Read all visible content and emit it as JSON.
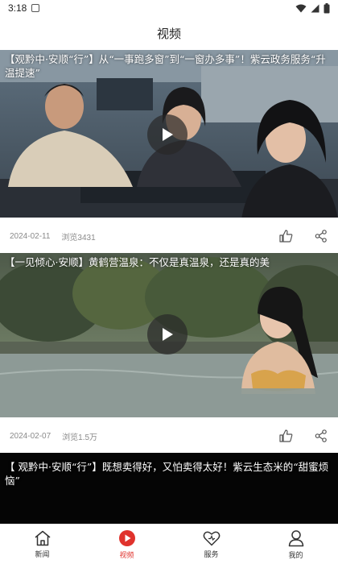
{
  "status_bar": {
    "time": "3:18"
  },
  "header": {
    "title": "视频"
  },
  "videos": [
    {
      "caption": "【观黔中·安顺“行”】从“一事跑多窗”到“一窗办多事”！紫云政务服务“升温提速”",
      "date": "2024-02-11",
      "views": "浏览3431"
    },
    {
      "caption": "【一见倾心·安顺】黄鹤营温泉：不仅是真温泉，还是真的美",
      "date": "2024-02-07",
      "views": "浏览1.5万"
    },
    {
      "caption": "【 观黔中·安顺“行”】既想卖得好，又怕卖得太好！紫云生态米的“甜蜜烦恼”"
    }
  ],
  "tabbar": {
    "items": [
      {
        "label": "新闻",
        "icon": "home-icon"
      },
      {
        "label": "视频",
        "icon": "play-circle-icon",
        "active": true
      },
      {
        "label": "服务",
        "icon": "heart-icon"
      },
      {
        "label": "我的",
        "icon": "user-icon"
      }
    ]
  },
  "colors": {
    "accent": "#e0322c",
    "background": "#f4f4f4"
  }
}
